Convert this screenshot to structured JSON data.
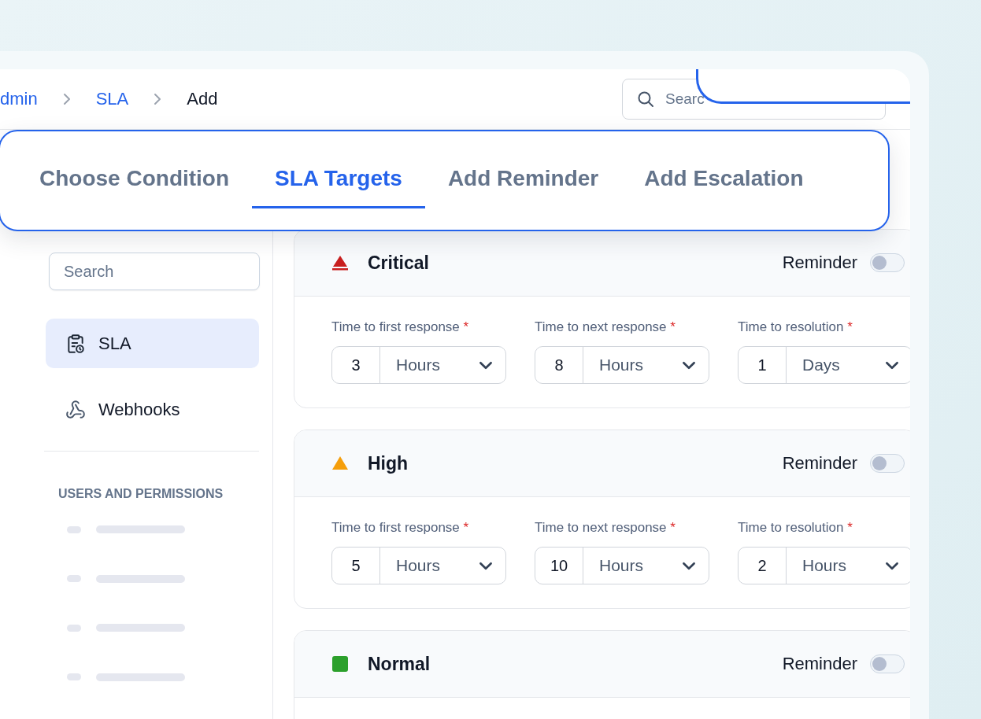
{
  "breadcrumb": [
    {
      "label": "dmin",
      "current": false
    },
    {
      "label": "SLA",
      "current": false
    },
    {
      "label": "Add",
      "current": true
    }
  ],
  "header_search": {
    "placeholder": "Searc"
  },
  "tabs": [
    {
      "label": "Choose Condition",
      "selected": false
    },
    {
      "label": "SLA Targets",
      "selected": true
    },
    {
      "label": "Add Reminder",
      "selected": false
    },
    {
      "label": "Add Escalation",
      "selected": false
    }
  ],
  "sidebar": {
    "search": {
      "placeholder": "Search"
    },
    "items": [
      {
        "label": "SLA",
        "kind": "sla",
        "selected": true
      },
      {
        "label": "Webhooks",
        "kind": "webhooks",
        "selected": false
      }
    ],
    "section_title": "USERS AND PERMISSIONS"
  },
  "priorities": [
    {
      "name": "Critical",
      "kind": "critical",
      "color": "#c81e1e",
      "reminder_label": "Reminder",
      "reminder_on": false,
      "targets": [
        {
          "label": "Time to first response",
          "required_mark": "*",
          "value": "3",
          "unit": "Hours"
        },
        {
          "label": "Time to next response",
          "required_mark": "*",
          "value": "8",
          "unit": "Hours"
        },
        {
          "label": "Time to resolution",
          "required_mark": "*",
          "value": "1",
          "unit": "Days"
        }
      ]
    },
    {
      "name": "High",
      "kind": "high",
      "color": "#f59e0b",
      "reminder_label": "Reminder",
      "reminder_on": false,
      "targets": [
        {
          "label": "Time to first response",
          "required_mark": "*",
          "value": "5",
          "unit": "Hours"
        },
        {
          "label": "Time to next response",
          "required_mark": "*",
          "value": "10",
          "unit": "Hours"
        },
        {
          "label": "Time to resolution",
          "required_mark": "*",
          "value": "2",
          "unit": "Hours"
        }
      ]
    },
    {
      "name": "Normal",
      "kind": "normal",
      "color": "#2ca02c",
      "reminder_label": "Reminder",
      "reminder_on": false
    }
  ]
}
